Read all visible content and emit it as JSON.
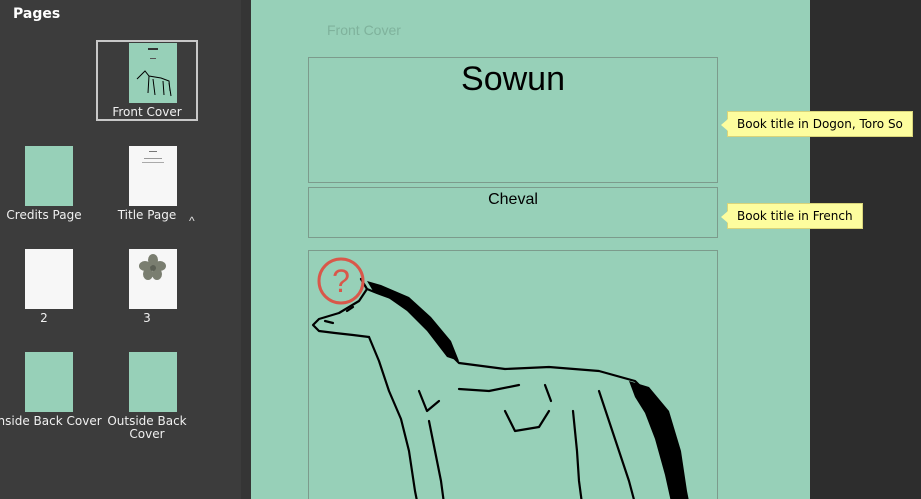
{
  "sidebar": {
    "title": "Pages",
    "collapse_glyph": "^",
    "pages": [
      {
        "label": "Front Cover",
        "selected": true
      },
      {
        "label": "Credits Page"
      },
      {
        "label": "Title Page"
      },
      {
        "label": "2"
      },
      {
        "label": "3"
      },
      {
        "label": "Inside Back Cover"
      },
      {
        "label": "Outside Back\nCover"
      }
    ]
  },
  "editor": {
    "page_label": "Front Cover",
    "title_vernacular": "Sowun",
    "title_national": "Cheval",
    "image_missing_icon": "question-mark-icon"
  },
  "tooltips": {
    "vernacular": "Book title in Dogon, Toro So",
    "national": "Book title in French"
  },
  "colors": {
    "page_background": "#97d0b8",
    "sidebar_background": "#3c3c3c",
    "tooltip_background": "#fdfd9e",
    "missing_image_icon": "#d9574a"
  }
}
